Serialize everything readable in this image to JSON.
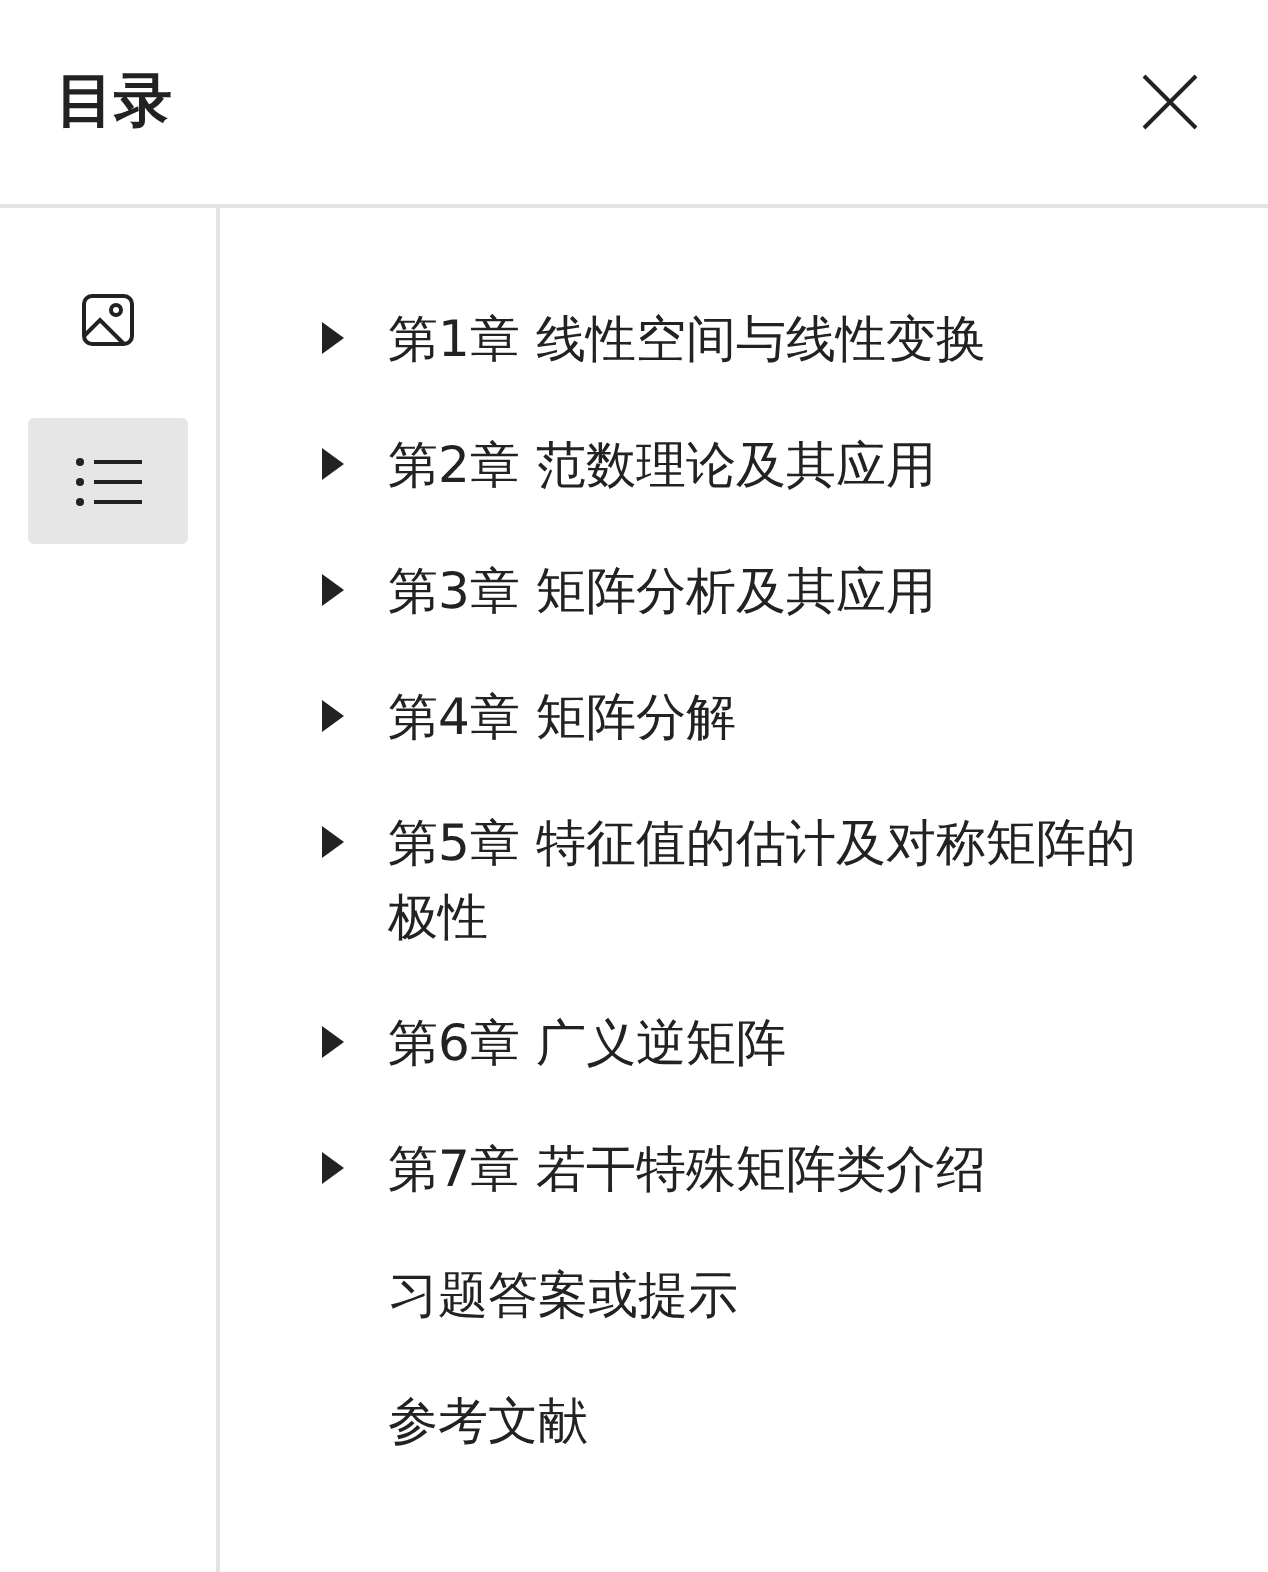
{
  "header": {
    "title": "目录"
  },
  "rail": [
    {
      "kind": "image",
      "selected": false
    },
    {
      "kind": "list",
      "selected": true
    }
  ],
  "toc": [
    {
      "label": "第1章 线性空间与线性变换",
      "expanded": false
    },
    {
      "label": "第2章 范数理论及其应用",
      "expanded": false
    },
    {
      "label": "第3章 矩阵分析及其应用",
      "expanded": false
    },
    {
      "label": "第4章 矩阵分解",
      "expanded": false
    },
    {
      "label": "第5章 特征值的估计及对称矩阵的极性",
      "expanded": false
    },
    {
      "label": "第6章 广义逆矩阵",
      "expanded": false
    },
    {
      "label": "第7章 若干特殊矩阵类介绍",
      "expanded": false
    },
    {
      "label": "习题答案或提示"
    },
    {
      "label": "参考文献"
    }
  ]
}
